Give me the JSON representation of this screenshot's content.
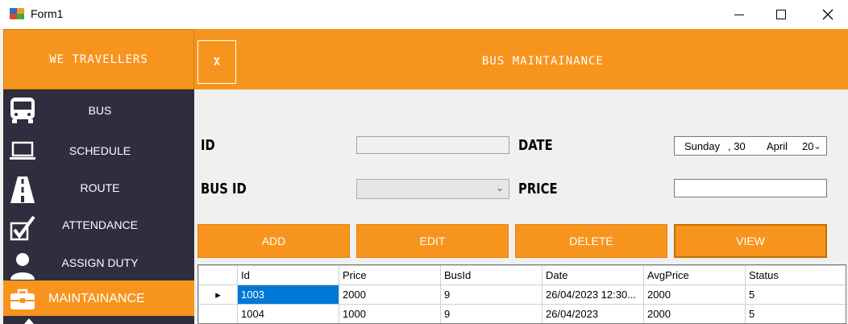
{
  "window": {
    "title": "Form1"
  },
  "brand": {
    "name": "WE TRAVELLERS"
  },
  "header": {
    "close_label": "X",
    "title": "BUS MAINTAINANCE"
  },
  "sidebar": {
    "items": [
      {
        "label": "BUS",
        "icon": "bus-icon",
        "active": false
      },
      {
        "label": "SCHEDULE",
        "icon": "laptop-icon",
        "active": false
      },
      {
        "label": "ROUTE",
        "icon": "road-icon",
        "active": false
      },
      {
        "label": "ATTENDANCE",
        "icon": "checkmark-icon",
        "active": false
      },
      {
        "label": "ASSIGN DUTY",
        "icon": "person-icon",
        "active": false
      },
      {
        "label": "MAINTAINANCE",
        "icon": "toolbox-icon",
        "active": true
      }
    ]
  },
  "form": {
    "id_label": "ID",
    "id_value": "",
    "busid_label": "BUS ID",
    "busid_value": "",
    "date_label": "DATE",
    "date_day": "Sunday",
    "date_daynum": ", 30",
    "date_month": "April",
    "date_year": "20",
    "price_label": "PRICE",
    "price_value": ""
  },
  "buttons": {
    "add": "ADD",
    "edit": "EDIT",
    "delete": "DELETE",
    "view": "VIEW"
  },
  "grid": {
    "columns": [
      "Id",
      "Price",
      "BusId",
      "Date",
      "AvgPrice",
      "Status"
    ],
    "rows": [
      {
        "current": true,
        "cells": [
          "1003",
          "2000",
          "9",
          "26/04/2023 12:30...",
          "2000",
          "5"
        ]
      },
      {
        "current": false,
        "cells": [
          "1004",
          "1000",
          "9",
          "26/04/2023",
          "2000",
          "5"
        ]
      }
    ]
  },
  "colors": {
    "accent": "#f7941d",
    "sidebar_bg": "#2e2e3e",
    "selection": "#0078d7"
  }
}
